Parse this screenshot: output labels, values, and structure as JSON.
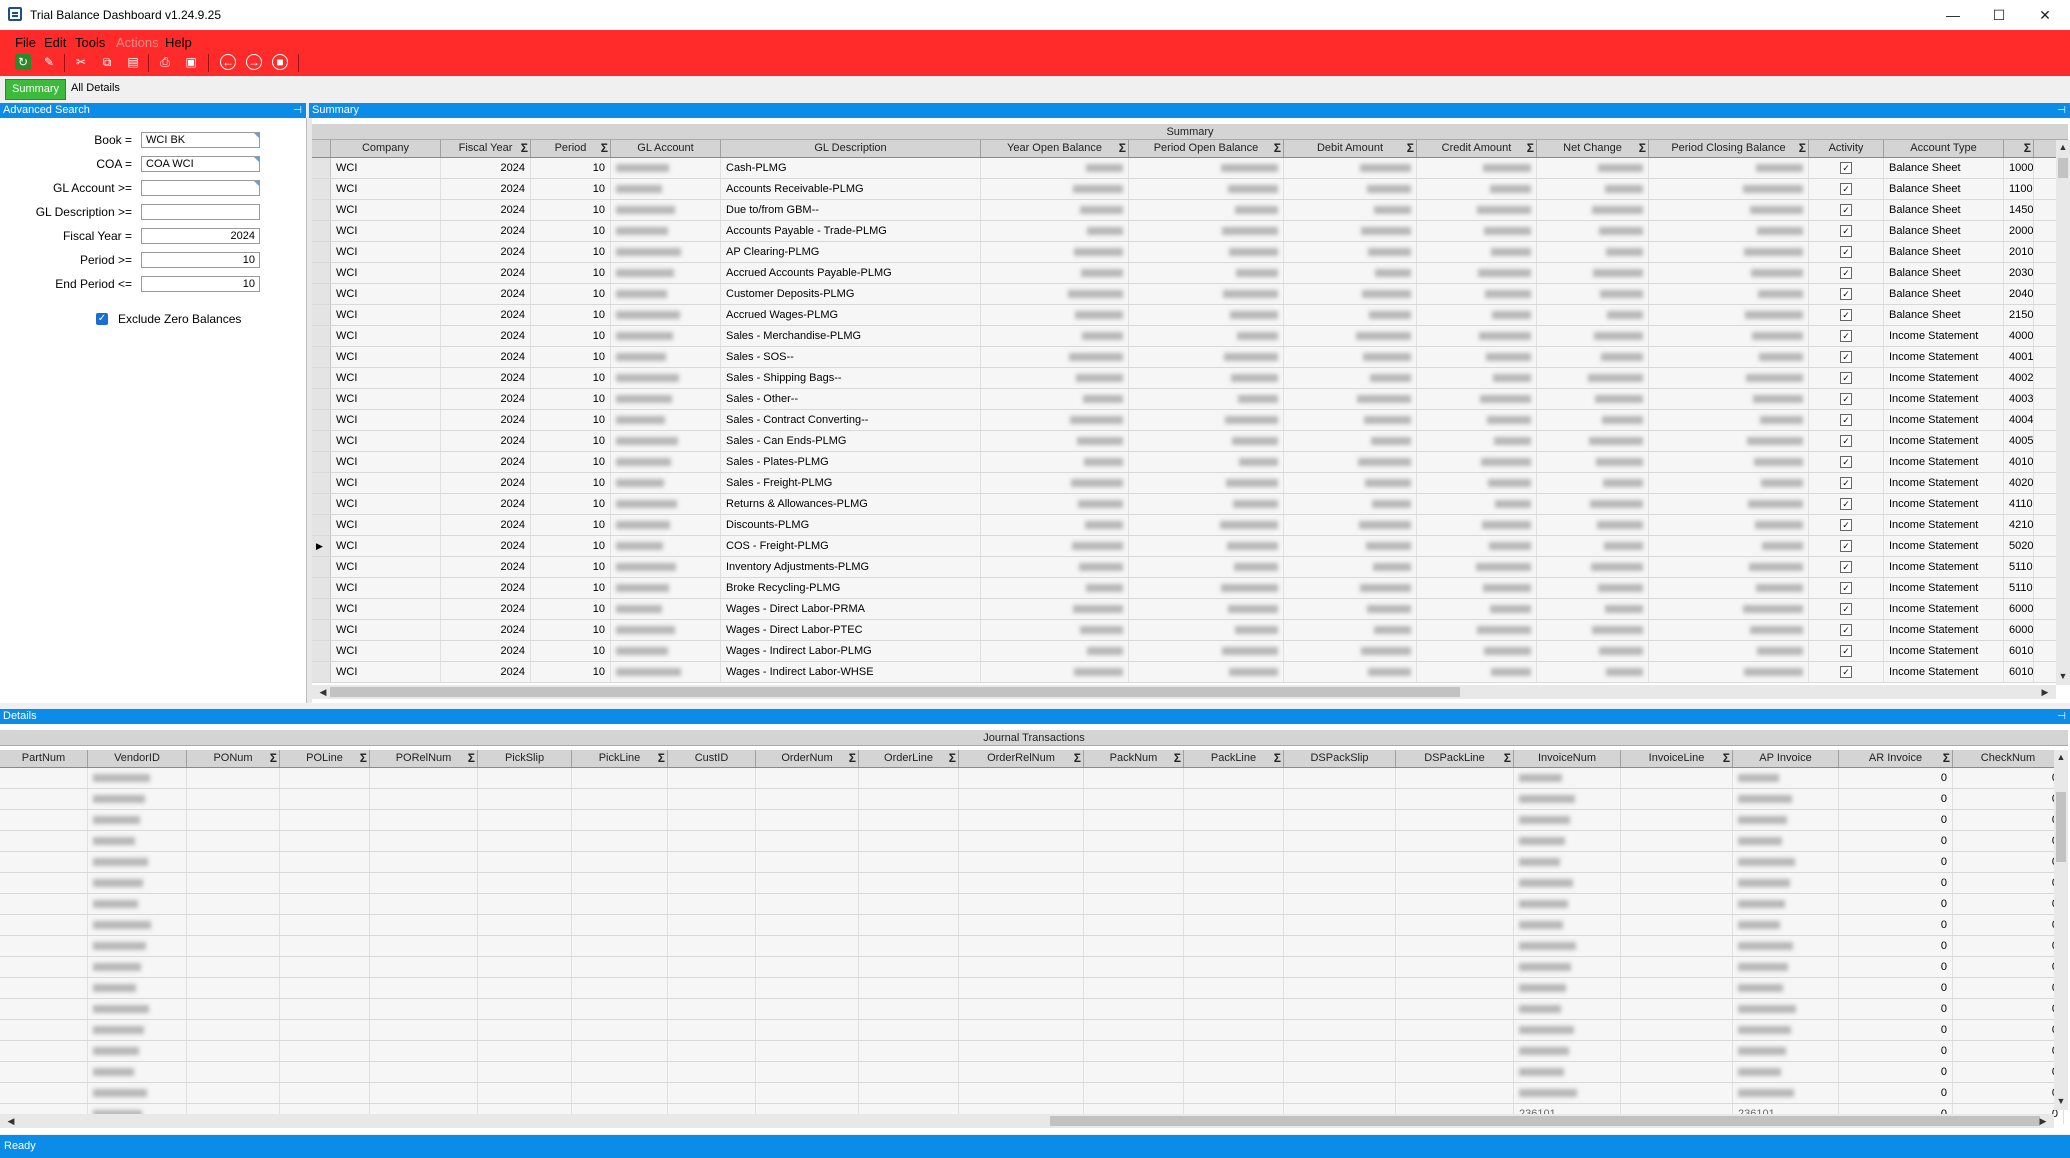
{
  "window": {
    "title": "Trial Balance Dashboard v1.24.9.25",
    "minimize": "—",
    "maximize": "☐",
    "close": "✕"
  },
  "menu": {
    "file": "File",
    "edit": "Edit",
    "tools": "Tools",
    "actions": "Actions",
    "help": "Help"
  },
  "toolbar_icons": [
    "refresh-icon",
    "clear-icon",
    "cut-icon",
    "copy-icon",
    "paste-icon",
    "print-icon",
    "print-preview-icon",
    "back-icon",
    "forward-icon",
    "stop-icon"
  ],
  "tabs": {
    "summary": "Summary",
    "all_details": "All Details"
  },
  "advanced_search": {
    "header": "Advanced Search",
    "book_label": "Book =",
    "book_value": "WCI BK",
    "coa_label": "COA =",
    "coa_value": "COA WCI",
    "gl_account_label": "GL Account >=",
    "gl_account_value": "",
    "gl_desc_label": "GL Description >=",
    "gl_desc_value": "",
    "fiscal_year_label": "Fiscal Year =",
    "fiscal_year_value": "2024",
    "period_label": "Period >=",
    "period_value": "10",
    "end_period_label": "End Period <=",
    "end_period_value": "10",
    "exclude_zero_label": "Exclude Zero Balances",
    "exclude_zero_checked": true
  },
  "summary": {
    "header": "Summary",
    "band": "Summary",
    "columns": [
      "Company",
      "Fiscal Year",
      "Period",
      "GL Account",
      "GL Description",
      "Year Open Balance",
      "Period Open Balance",
      "Debit Amount",
      "Credit Amount",
      "Net Change",
      "Period Closing Balance",
      "Activity",
      "Account Type",
      ""
    ],
    "rows": [
      {
        "company": "WCI",
        "year": "2024",
        "period": "10",
        "desc": "Cash-PLMG",
        "type": "Balance Sheet",
        "acct": "1000"
      },
      {
        "company": "WCI",
        "year": "2024",
        "period": "10",
        "desc": "Accounts Receivable-PLMG",
        "type": "Balance Sheet",
        "acct": "1100"
      },
      {
        "company": "WCI",
        "year": "2024",
        "period": "10",
        "desc": "Due to/from GBM--",
        "type": "Balance Sheet",
        "acct": "1450"
      },
      {
        "company": "WCI",
        "year": "2024",
        "period": "10",
        "desc": "Accounts Payable - Trade-PLMG",
        "type": "Balance Sheet",
        "acct": "2000"
      },
      {
        "company": "WCI",
        "year": "2024",
        "period": "10",
        "desc": "AP Clearing-PLMG",
        "type": "Balance Sheet",
        "acct": "2010"
      },
      {
        "company": "WCI",
        "year": "2024",
        "period": "10",
        "desc": "Accrued Accounts Payable-PLMG",
        "type": "Balance Sheet",
        "acct": "2030"
      },
      {
        "company": "WCI",
        "year": "2024",
        "period": "10",
        "desc": "Customer Deposits-PLMG",
        "type": "Balance Sheet",
        "acct": "2040"
      },
      {
        "company": "WCI",
        "year": "2024",
        "period": "10",
        "desc": "Accrued Wages-PLMG",
        "type": "Balance Sheet",
        "acct": "2150"
      },
      {
        "company": "WCI",
        "year": "2024",
        "period": "10",
        "desc": "Sales - Merchandise-PLMG",
        "type": "Income Statement",
        "acct": "4000"
      },
      {
        "company": "WCI",
        "year": "2024",
        "period": "10",
        "desc": "Sales - SOS--",
        "type": "Income Statement",
        "acct": "4001"
      },
      {
        "company": "WCI",
        "year": "2024",
        "period": "10",
        "desc": "Sales - Shipping Bags--",
        "type": "Income Statement",
        "acct": "4002"
      },
      {
        "company": "WCI",
        "year": "2024",
        "period": "10",
        "desc": "Sales - Other--",
        "type": "Income Statement",
        "acct": "4003"
      },
      {
        "company": "WCI",
        "year": "2024",
        "period": "10",
        "desc": "Sales - Contract Converting--",
        "type": "Income Statement",
        "acct": "4004"
      },
      {
        "company": "WCI",
        "year": "2024",
        "period": "10",
        "desc": "Sales - Can Ends-PLMG",
        "type": "Income Statement",
        "acct": "4005"
      },
      {
        "company": "WCI",
        "year": "2024",
        "period": "10",
        "desc": "Sales - Plates-PLMG",
        "type": "Income Statement",
        "acct": "4010"
      },
      {
        "company": "WCI",
        "year": "2024",
        "period": "10",
        "desc": "Sales - Freight-PLMG",
        "type": "Income Statement",
        "acct": "4020"
      },
      {
        "company": "WCI",
        "year": "2024",
        "period": "10",
        "desc": "Returns & Allowances-PLMG",
        "type": "Income Statement",
        "acct": "4110"
      },
      {
        "company": "WCI",
        "year": "2024",
        "period": "10",
        "desc": "Discounts-PLMG",
        "type": "Income Statement",
        "acct": "4210"
      },
      {
        "company": "WCI",
        "year": "2024",
        "period": "10",
        "desc": "COS - Freight-PLMG",
        "type": "Income Statement",
        "acct": "5020"
      },
      {
        "company": "WCI",
        "year": "2024",
        "period": "10",
        "desc": "Inventory Adjustments-PLMG",
        "type": "Income Statement",
        "acct": "5110"
      },
      {
        "company": "WCI",
        "year": "2024",
        "period": "10",
        "desc": "Broke Recycling-PLMG",
        "type": "Income Statement",
        "acct": "5110"
      },
      {
        "company": "WCI",
        "year": "2024",
        "period": "10",
        "desc": "Wages - Direct Labor-PRMA",
        "type": "Income Statement",
        "acct": "6000"
      },
      {
        "company": "WCI",
        "year": "2024",
        "period": "10",
        "desc": "Wages - Direct Labor-PTEC",
        "type": "Income Statement",
        "acct": "6000"
      },
      {
        "company": "WCI",
        "year": "2024",
        "period": "10",
        "desc": "Wages - Indirect Labor-PLMG",
        "type": "Income Statement",
        "acct": "6010"
      },
      {
        "company": "WCI",
        "year": "2024",
        "period": "10",
        "desc": "Wages - Indirect Labor-WHSE",
        "type": "Income Statement",
        "acct": "6010"
      }
    ]
  },
  "details": {
    "header": "Details",
    "band": "Journal Transactions",
    "columns": [
      "PartNum",
      "VendorID",
      "PONum",
      "POLine",
      "PORelNum",
      "PickSlip",
      "PickLine",
      "CustID",
      "OrderNum",
      "OrderLine",
      "OrderRelNum",
      "PackNum",
      "PackLine",
      "DSPackSlip",
      "DSPackLine",
      "InvoiceNum",
      "InvoiceLine",
      "AP Invoice",
      "AR Invoice",
      "CheckNum"
    ],
    "row_count": 17,
    "zero": "0",
    "partial_invoice": "236101"
  },
  "status": "Ready"
}
